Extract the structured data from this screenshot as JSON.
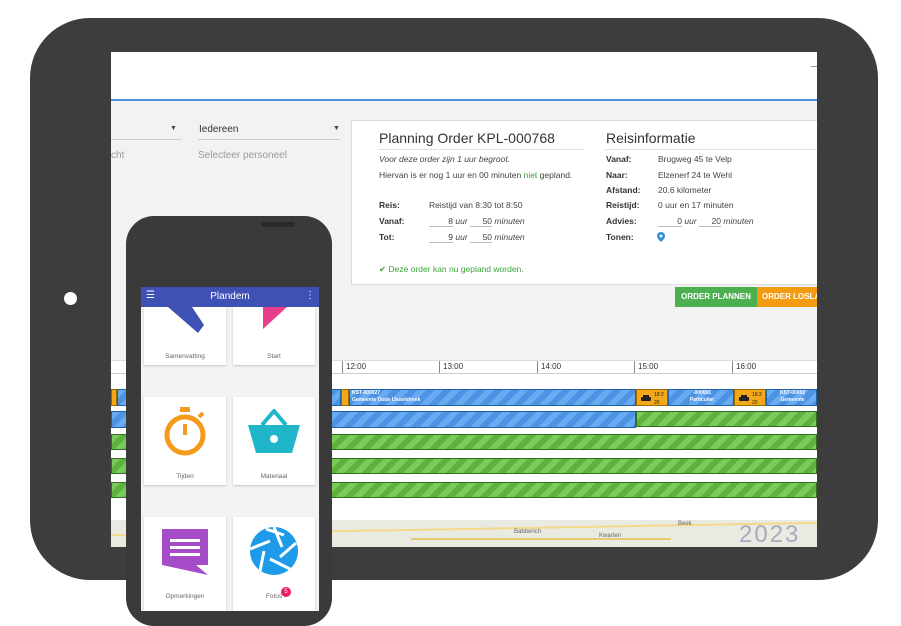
{
  "planner": {
    "select_person": "Iedereen",
    "select_person_placeholder": "Selecteer personeel",
    "left_placeholder": "cht"
  },
  "planning_panel": {
    "title": "Planning Order KPL-000768",
    "note": "Voor deze order zijn 1 uur begroot.",
    "remaining_pre": "Hiervan is er nog 1 uur en 00 minuten ",
    "remaining_highlight": "niet",
    "remaining_post": " gepland.",
    "reis_label": "Reis:",
    "reis_value": "Reistijd van 8:30 tot 8:50",
    "vanaf_label": "Vanaf:",
    "vanaf_hours": "8",
    "vanaf_minutes": "50",
    "tot_label": "Tot:",
    "tot_hours": "9",
    "tot_minutes": "50",
    "unit_uur": "uur",
    "unit_minuten": "minuten",
    "status": "✔ Deze order kan nu gepland worden."
  },
  "travel_panel": {
    "title": "Reisinformatie",
    "rows": [
      {
        "label": "Vanaf:",
        "value": "Brugweg 45 te Velp"
      },
      {
        "label": "Naar:",
        "value": "Elzenerf 24 te Wehl"
      },
      {
        "label": "Afstand:",
        "value": "20.6 kilometer"
      },
      {
        "label": "Reistijd:",
        "value": "0 uur en 17 minuten"
      }
    ],
    "advies_label": "Advies:",
    "advies_hours": "0",
    "advies_minutes": "20",
    "tonen_label": "Tonen:"
  },
  "buttons": {
    "plan": "ORDER PLANNEN",
    "unplan": "ORDER LOSLA"
  },
  "colors": {
    "plan_button": "#4caf50",
    "unplan_button": "#f39c12",
    "phone_bar": "#3f51b5"
  },
  "timeline": {
    "hours": [
      "12:00",
      "13:00",
      "14:00",
      "15:00",
      "16:00"
    ],
    "segments": [
      {
        "code": "KST-000027",
        "name": "Gemeente Oude IJsselstreek"
      },
      {
        "code": "-000001",
        "name": "Particulier"
      },
      {
        "code": "KST-00002",
        "name": "Gemeente"
      }
    ],
    "car_time": "18:2 20"
  },
  "map": {
    "labels": [
      "Babberich",
      "Kwarten",
      "Beek"
    ],
    "watermark": "2023"
  },
  "phone": {
    "title": "Plandem",
    "tiles": [
      {
        "label": "Samenvatting",
        "icon": "summary-icon"
      },
      {
        "label": "Start",
        "icon": "start-icon"
      },
      {
        "label": "Tijden",
        "icon": "stopwatch-icon"
      },
      {
        "label": "Materiaal",
        "icon": "basket-icon"
      },
      {
        "label": "Opmerkingen",
        "icon": "comment-icon"
      },
      {
        "label": "Fotos",
        "icon": "camera-aperture-icon"
      }
    ],
    "photo_badge": "5"
  }
}
